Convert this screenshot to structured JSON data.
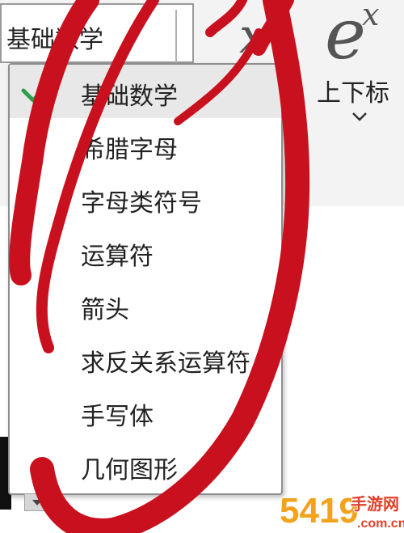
{
  "category_select": {
    "value": "基础数学"
  },
  "script_tool": {
    "glyph_base": "e",
    "glyph_sup": "x",
    "label": "上下标",
    "partial_glyph": "x"
  },
  "menu": {
    "items": [
      {
        "label": "基础数学",
        "selected": true
      },
      {
        "label": "希腊字母",
        "selected": false
      },
      {
        "label": "字母类符号",
        "selected": false
      },
      {
        "label": "运算符",
        "selected": false
      },
      {
        "label": "箭头",
        "selected": false
      },
      {
        "label": "求反关系运算符",
        "selected": false
      },
      {
        "label": "手写体",
        "selected": false
      },
      {
        "label": "几何图形",
        "selected": false
      }
    ]
  },
  "watermark": {
    "digits": "5419",
    "text": "手游网",
    "domain": ".com.cn"
  },
  "colors": {
    "annotation_red": "#c8101e",
    "check_green": "#2e9e4a",
    "selected_bg": "#e8e8e8"
  }
}
